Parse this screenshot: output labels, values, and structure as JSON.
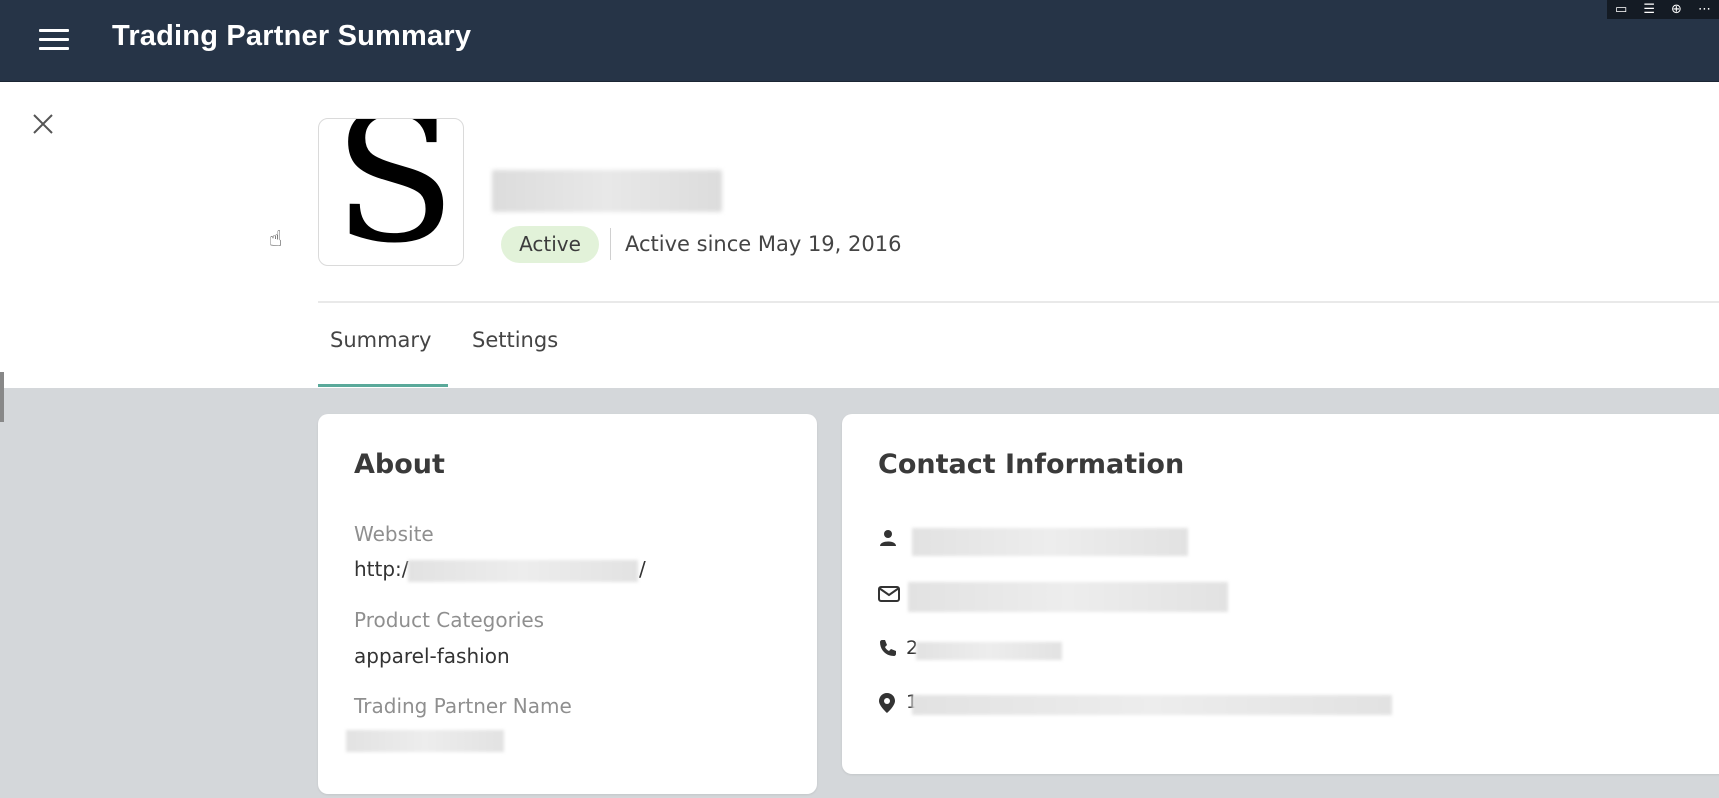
{
  "header": {
    "title": "Trading Partner Summary"
  },
  "window_controls": [
    "comment-icon",
    "panel-icon",
    "download-icon",
    "more-icon"
  ],
  "partner": {
    "logo_letter": "S",
    "status": "Active",
    "active_since": "Active since May 19, 2016"
  },
  "tabs": [
    {
      "label": "Summary",
      "selected": true
    },
    {
      "label": "Settings",
      "selected": false
    }
  ],
  "about": {
    "title": "About",
    "website_label": "Website",
    "website_value": "http:/",
    "website_suffix": "/",
    "categories_label": "Product Categories",
    "categories_value": "apparel-fashion",
    "partner_name_label": "Trading Partner Name"
  },
  "contact": {
    "title": "Contact Information",
    "phone_prefix": "2",
    "address_prefix": "1"
  },
  "colors": {
    "topbar": "#263447",
    "accent": "#5aa99a",
    "badge_bg": "#e2f2d9",
    "page_bg": "#d4d7da"
  }
}
